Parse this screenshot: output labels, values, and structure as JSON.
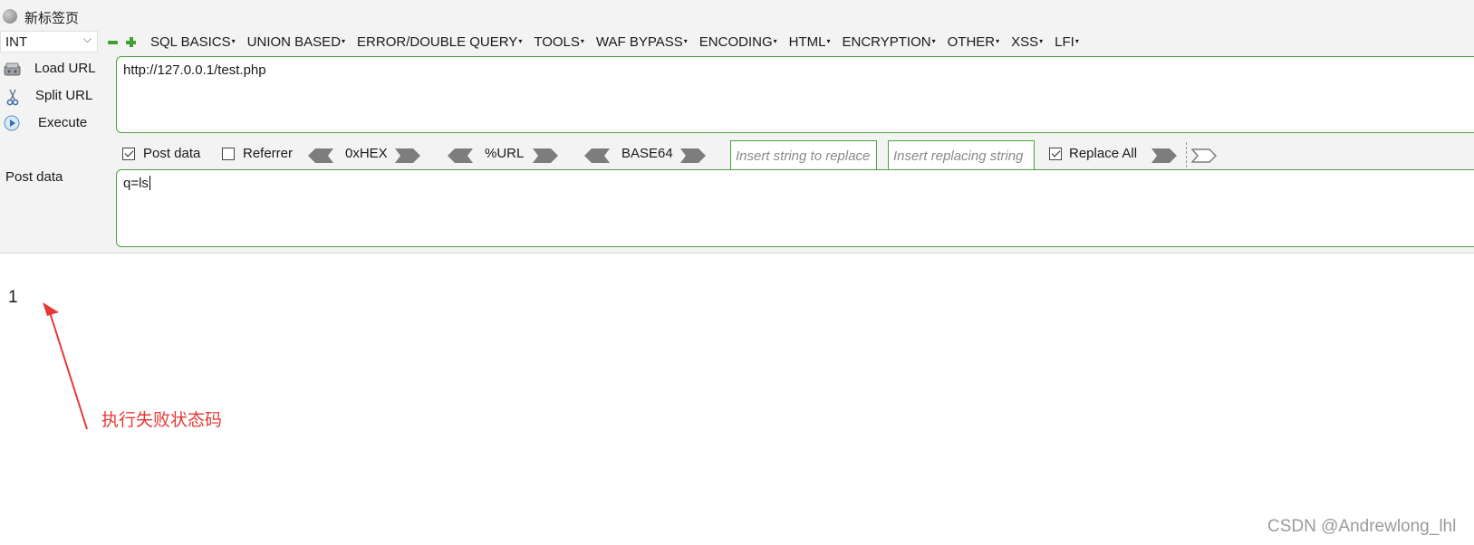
{
  "tab": {
    "title": "新标签页"
  },
  "toolbar": {
    "int_select": "INT",
    "menus": [
      "SQL BASICS",
      "UNION BASED",
      "ERROR/DOUBLE QUERY",
      "TOOLS",
      "WAF BYPASS",
      "ENCODING",
      "HTML",
      "ENCRYPTION",
      "OTHER",
      "XSS",
      "LFI"
    ]
  },
  "side": {
    "load_url": "Load URL",
    "split_url": "Split URL",
    "execute": "Execute"
  },
  "url": {
    "value": "http://127.0.0.1/test.php"
  },
  "options": {
    "post_data": {
      "label": "Post data",
      "checked": true
    },
    "referrer": {
      "label": "Referrer",
      "checked": false
    },
    "hex": "0xHEX",
    "url_enc": "%URL",
    "base64": "BASE64",
    "replace_find_placeholder": "Insert string to replace",
    "replace_with_placeholder": "Insert replacing string",
    "replace_all": {
      "label": "Replace All",
      "checked": true
    }
  },
  "post": {
    "label": "Post data",
    "value": "q=ls"
  },
  "page": {
    "result": "1"
  },
  "annotation": {
    "text": "执行失败状态码",
    "color": "#e53935"
  },
  "watermark": "CSDN @Andrewlong_lhl"
}
